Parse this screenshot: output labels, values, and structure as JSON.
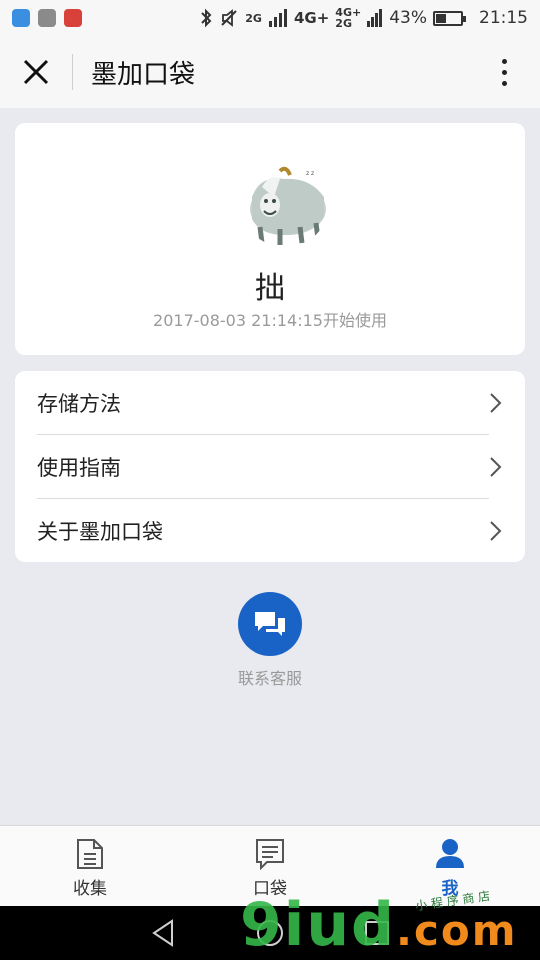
{
  "status_bar": {
    "network_2g": "2G",
    "network_4g": "4G+",
    "network_4g_small": "4G+",
    "network_2g_small": "2G",
    "battery_percent": "43%",
    "battery_level": 0.43,
    "time": "21:15",
    "icons": [
      "bluetooth-icon",
      "mute-icon",
      "signal-icon",
      "battery-icon"
    ]
  },
  "nav": {
    "title": "墨加口袋",
    "close_icon": "close-icon",
    "more_icon": "more-vertical-icon"
  },
  "profile": {
    "name": "拙",
    "started": "2017-08-03 21:14:15开始使用",
    "avatar": "bear-avatar"
  },
  "menu": {
    "items": [
      {
        "label": "存储方法"
      },
      {
        "label": "使用指南"
      },
      {
        "label": "关于墨加口袋"
      }
    ]
  },
  "contact": {
    "label": "联系客服",
    "icon": "chat-bubbles-icon",
    "color": "#1a63c6"
  },
  "tabs": [
    {
      "label": "收集",
      "icon": "document-icon"
    },
    {
      "label": "口袋",
      "icon": "message-icon"
    },
    {
      "label": "我",
      "icon": "user-icon",
      "active": true
    }
  ],
  "watermark": {
    "main_a": "9iud",
    "main_b": ".com",
    "small": "小 程 序 商 店"
  },
  "colors": {
    "accent": "#1a63c6",
    "background": "#e8eaef"
  }
}
